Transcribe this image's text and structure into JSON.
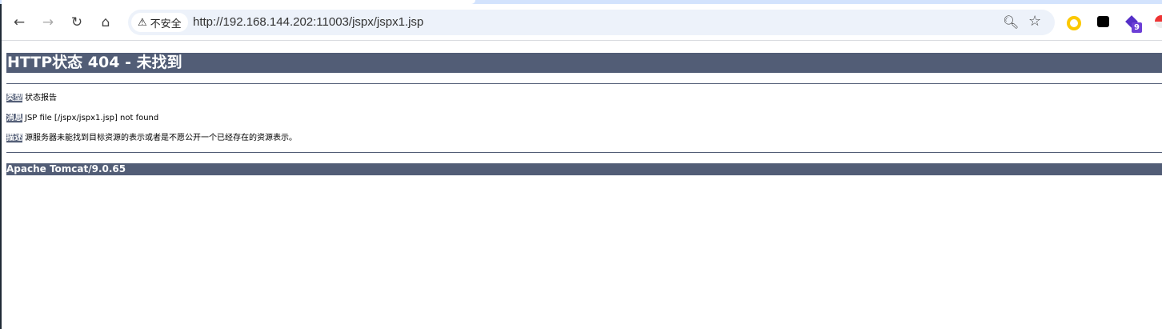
{
  "browser": {
    "security_label": "不安全",
    "url": "http://192.168.144.202:11003/jspx/jspx1.jsp",
    "extension_badge": "9"
  },
  "error_page": {
    "title": "HTTP状态 404 - 未找到",
    "rows": [
      {
        "label": "类型",
        "value": "状态报告"
      },
      {
        "label": "消息",
        "value": "JSP file [/jspx/jspx1.jsp] not found"
      },
      {
        "label": "描述",
        "value": "源服务器未能找到目标资源的表示或者是不愿公开一个已经存在的资源表示。"
      }
    ],
    "footer": "Apache Tomcat/9.0.65"
  },
  "colors": {
    "header_bg": "#525d76",
    "omnibox_bg": "#edf2fa"
  }
}
